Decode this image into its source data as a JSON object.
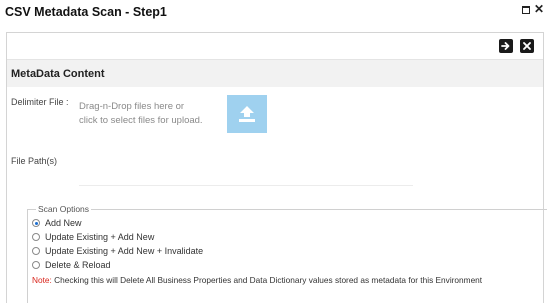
{
  "window": {
    "title": "CSV Metadata Scan - Step1"
  },
  "section": {
    "title": "MetaData Content"
  },
  "fields": {
    "delimiter_label": "Delimiter File :",
    "dropzone_line1": "Drag-n-Drop files here or",
    "dropzone_line2": "click to select files for upload.",
    "file_path_label": "File Path(s)"
  },
  "scan_options": {
    "legend": "Scan Options",
    "options": [
      {
        "label": "Add New",
        "checked": true
      },
      {
        "label": "Update Existing + Add New",
        "checked": false
      },
      {
        "label": "Update Existing + Add New + Invalidate",
        "checked": false
      },
      {
        "label": "Delete & Reload",
        "checked": false
      }
    ],
    "note_prefix": "Note:",
    "note_text": " Checking this will Delete All Business Properties and Data Dictionary values stored as metadata for this Environment"
  },
  "icons": {
    "next": "arrow-right-icon",
    "close": "close-icon",
    "upload": "upload-icon",
    "maximize": "maximize-icon"
  },
  "colors": {
    "upload_box": "#9fd1ef",
    "note_prefix": "#d9251c",
    "section_header_bg": "#f2f2f2"
  }
}
